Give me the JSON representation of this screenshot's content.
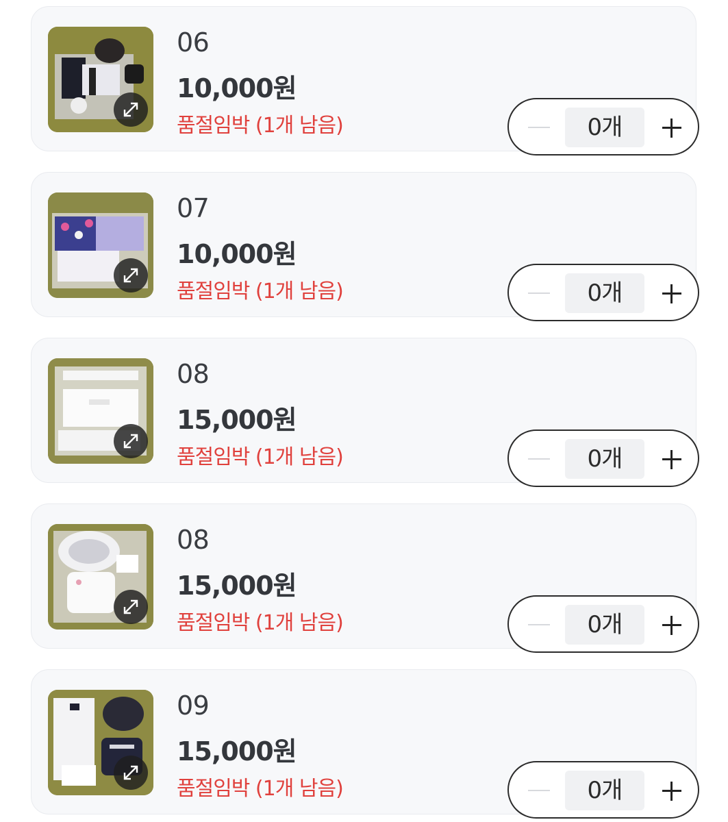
{
  "items": [
    {
      "name": "06",
      "price": "10,000원",
      "stock": "품절임박 (1개 남음)",
      "quantity": "0개",
      "image_icon": "product-photo-icon"
    },
    {
      "name": "07",
      "price": "10,000원",
      "stock": "품절임박 (1개 남음)",
      "quantity": "0개",
      "image_icon": "product-photo-icon"
    },
    {
      "name": "08",
      "price": "15,000원",
      "stock": "품절임박 (1개 남음)",
      "quantity": "0개",
      "image_icon": "product-photo-icon"
    },
    {
      "name": "08",
      "price": "15,000원",
      "stock": "품절임박 (1개 남음)",
      "quantity": "0개",
      "image_icon": "product-photo-icon"
    },
    {
      "name": "09",
      "price": "15,000원",
      "stock": "품절임박 (1개 남음)",
      "quantity": "0개",
      "image_icon": "product-photo-icon"
    }
  ],
  "colors": {
    "stock_warning": "#e0413d",
    "card_background": "#f7f8fa",
    "price_text": "#34373c"
  }
}
